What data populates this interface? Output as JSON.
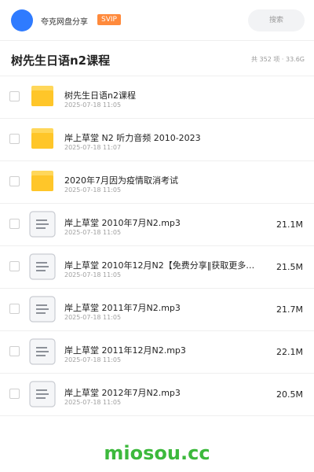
{
  "header": {
    "app_name": "夸克网盘分享",
    "badge": "SVIP",
    "search_placeholder": "搜索"
  },
  "folder": {
    "title": "树先生日语n2课程",
    "meta": "共 352 项 · 33.6G"
  },
  "items": [
    {
      "type": "folder",
      "icon": "folder-icon",
      "name": "树先生日语n2课程",
      "date": "2025-07-18 11:05",
      "size": ""
    },
    {
      "type": "folder",
      "icon": "folder-icon",
      "name": "岸上草堂 N2 听力音频 2010-2023",
      "date": "2025-07-18 11:07",
      "size": ""
    },
    {
      "type": "folder",
      "icon": "folder-icon",
      "name": "2020年7月因为疫情取消考试",
      "date": "2025-07-18 11:05",
      "size": ""
    },
    {
      "type": "file",
      "icon": "audio-file-icon",
      "name": "岸上草堂 2010年7月N2.mp3",
      "date": "2025-07-18 11:05",
      "size": "21.1M"
    },
    {
      "type": "file",
      "icon": "audio-file-icon",
      "name": "岸上草堂 2010年12月N2【免费分享‖获取更多…",
      "date": "2025-07-18 11:05",
      "size": "21.5M"
    },
    {
      "type": "file",
      "icon": "audio-file-icon",
      "name": "岸上草堂 2011年7月N2.mp3",
      "date": "2025-07-18 11:05",
      "size": "21.7M"
    },
    {
      "type": "file",
      "icon": "audio-file-icon",
      "name": "岸上草堂 2011年12月N2.mp3",
      "date": "2025-07-18 11:05",
      "size": "22.1M"
    },
    {
      "type": "file",
      "icon": "audio-file-icon",
      "name": "岸上草堂 2012年7月N2.mp3",
      "date": "2025-07-18 11:05",
      "size": "20.5M"
    }
  ],
  "watermark": "miosou.cc",
  "colors": {
    "avatar": "#2f7bff",
    "badge": "#ff8a3c",
    "folder": "#ffc629",
    "watermark": "#3cb93c"
  }
}
